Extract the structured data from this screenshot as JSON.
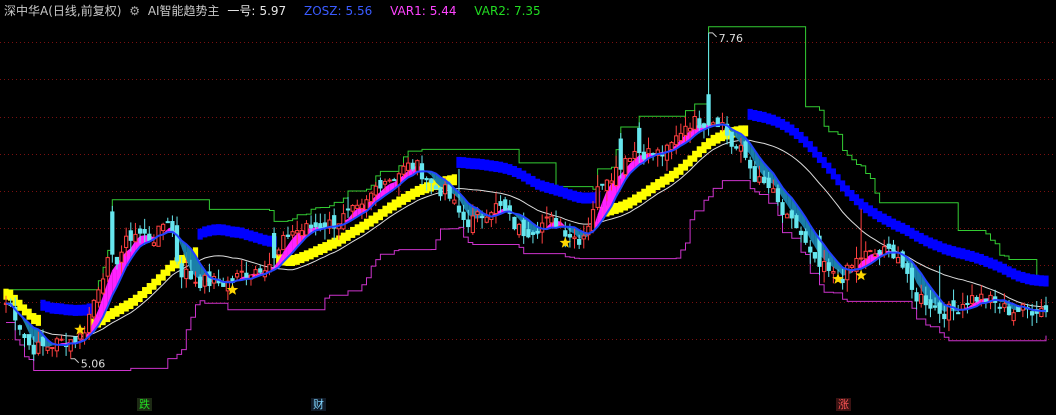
{
  "header": {
    "stock_title": "深中华A(日线,前复权)",
    "indicator_name": "AI智能趋势主",
    "items": [
      {
        "label": "一号:",
        "value": "5.97",
        "color": "#e6e6e6"
      },
      {
        "label": "ZOSZ:",
        "value": "5.56",
        "color": "#3a5bff"
      },
      {
        "label": "VAR1:",
        "value": "5.44",
        "color": "#ff44ff"
      },
      {
        "label": "VAR2:",
        "value": "7.35",
        "color": "#22dd22"
      }
    ]
  },
  "price_labels": {
    "high": "7.76",
    "low": "5.06"
  },
  "signals": [
    {
      "text": "跌",
      "color": "#22dd22",
      "bg": "#1d2a14",
      "bar": 30
    },
    {
      "text": "财",
      "color": "#7fd4ff",
      "bg": "#111b28",
      "bar": 67
    },
    {
      "text": "涨",
      "color": "#ff5555",
      "bg": "#3a1212",
      "bar": 186
    }
  ],
  "colors": {
    "up": "#ff4040",
    "down": "#66e6ee",
    "magenta": "#ff22ff",
    "yellow": "#ffff00",
    "blue_step": "#0000ff",
    "teal": "#1a7fa8",
    "ma_blue": "#2244ff",
    "white_line": "#dddddd",
    "green_line": "#33cc33",
    "purple_line": "#cc33cc",
    "star": "#ffd700"
  },
  "chart_data": {
    "type": "candlestick",
    "title": "深中华A(日线,前复权) AI智能趋势主",
    "bars": 226,
    "y_range": [
      4.95,
      7.85
    ],
    "anchors": [
      [
        0,
        5.52
      ],
      [
        6,
        5.15
      ],
      [
        15,
        5.22
      ],
      [
        23,
        5.87
      ],
      [
        28,
        6.1
      ],
      [
        32,
        6.06
      ],
      [
        35,
        6.22
      ],
      [
        38,
        5.78
      ],
      [
        42,
        5.7
      ],
      [
        48,
        5.69
      ],
      [
        52,
        5.78
      ],
      [
        57,
        5.85
      ],
      [
        62,
        6.12
      ],
      [
        70,
        6.18
      ],
      [
        76,
        6.28
      ],
      [
        82,
        6.55
      ],
      [
        88,
        6.66
      ],
      [
        94,
        6.46
      ],
      [
        100,
        6.2
      ],
      [
        106,
        6.32
      ],
      [
        112,
        6.12
      ],
      [
        118,
        6.2
      ],
      [
        124,
        6.06
      ],
      [
        130,
        6.58
      ],
      [
        136,
        6.78
      ],
      [
        142,
        6.76
      ],
      [
        148,
        7.02
      ],
      [
        154,
        7.04
      ],
      [
        158,
        6.8
      ],
      [
        164,
        6.5
      ],
      [
        170,
        6.18
      ],
      [
        176,
        5.82
      ],
      [
        180,
        5.73
      ],
      [
        186,
        5.92
      ],
      [
        192,
        5.95
      ],
      [
        197,
        5.58
      ],
      [
        203,
        5.45
      ],
      [
        210,
        5.57
      ],
      [
        218,
        5.46
      ],
      [
        225,
        5.48
      ]
    ],
    "high": 7.76,
    "low": 5.06
  }
}
